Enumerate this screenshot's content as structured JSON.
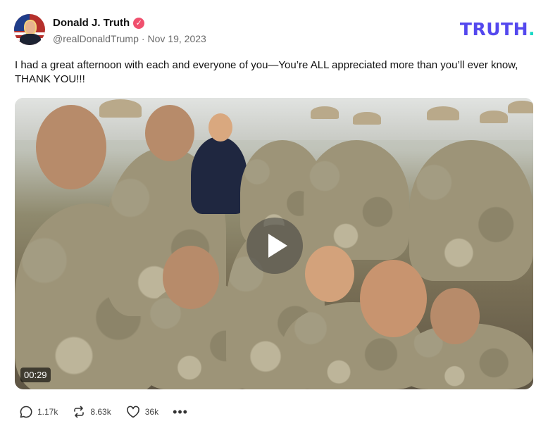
{
  "author": {
    "display_name": "Donald J. Truth",
    "handle": "@realDonaldTrump",
    "separator": "·",
    "date": "Nov 19, 2023",
    "verified_icon": "checkmark-badge-icon"
  },
  "brand": {
    "text": "TRUTH",
    "dot": ".",
    "color": "#5448ee",
    "dot_color": "#17d8c5"
  },
  "post": {
    "text": "I had a great afternoon with each and everyone of you—You’re ALL appreciated more than you’ll ever know, THANK YOU!!!"
  },
  "media": {
    "type": "video",
    "duration": "00:29",
    "play_icon": "play-icon"
  },
  "actions": {
    "replies": "1.17k",
    "retruths": "8.63k",
    "likes": "36k",
    "more": "•••"
  }
}
